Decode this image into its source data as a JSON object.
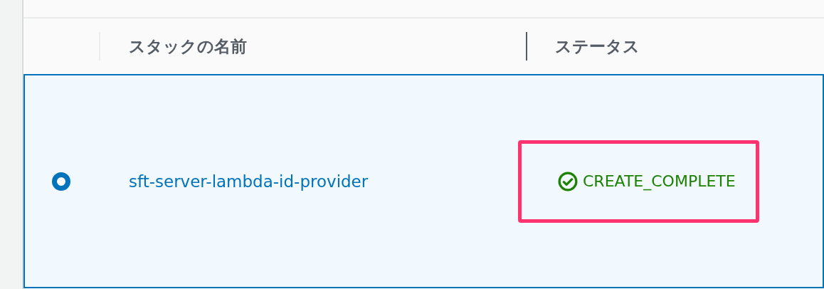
{
  "table": {
    "columns": [
      {
        "label": "スタックの名前"
      },
      {
        "label": "ステータス"
      }
    ],
    "rows": [
      {
        "selected": true,
        "name": "sft-server-lambda-id-provider",
        "status": {
          "text": "CREATE_COMPLETE",
          "kind": "success",
          "highlighted": true
        }
      }
    ]
  }
}
